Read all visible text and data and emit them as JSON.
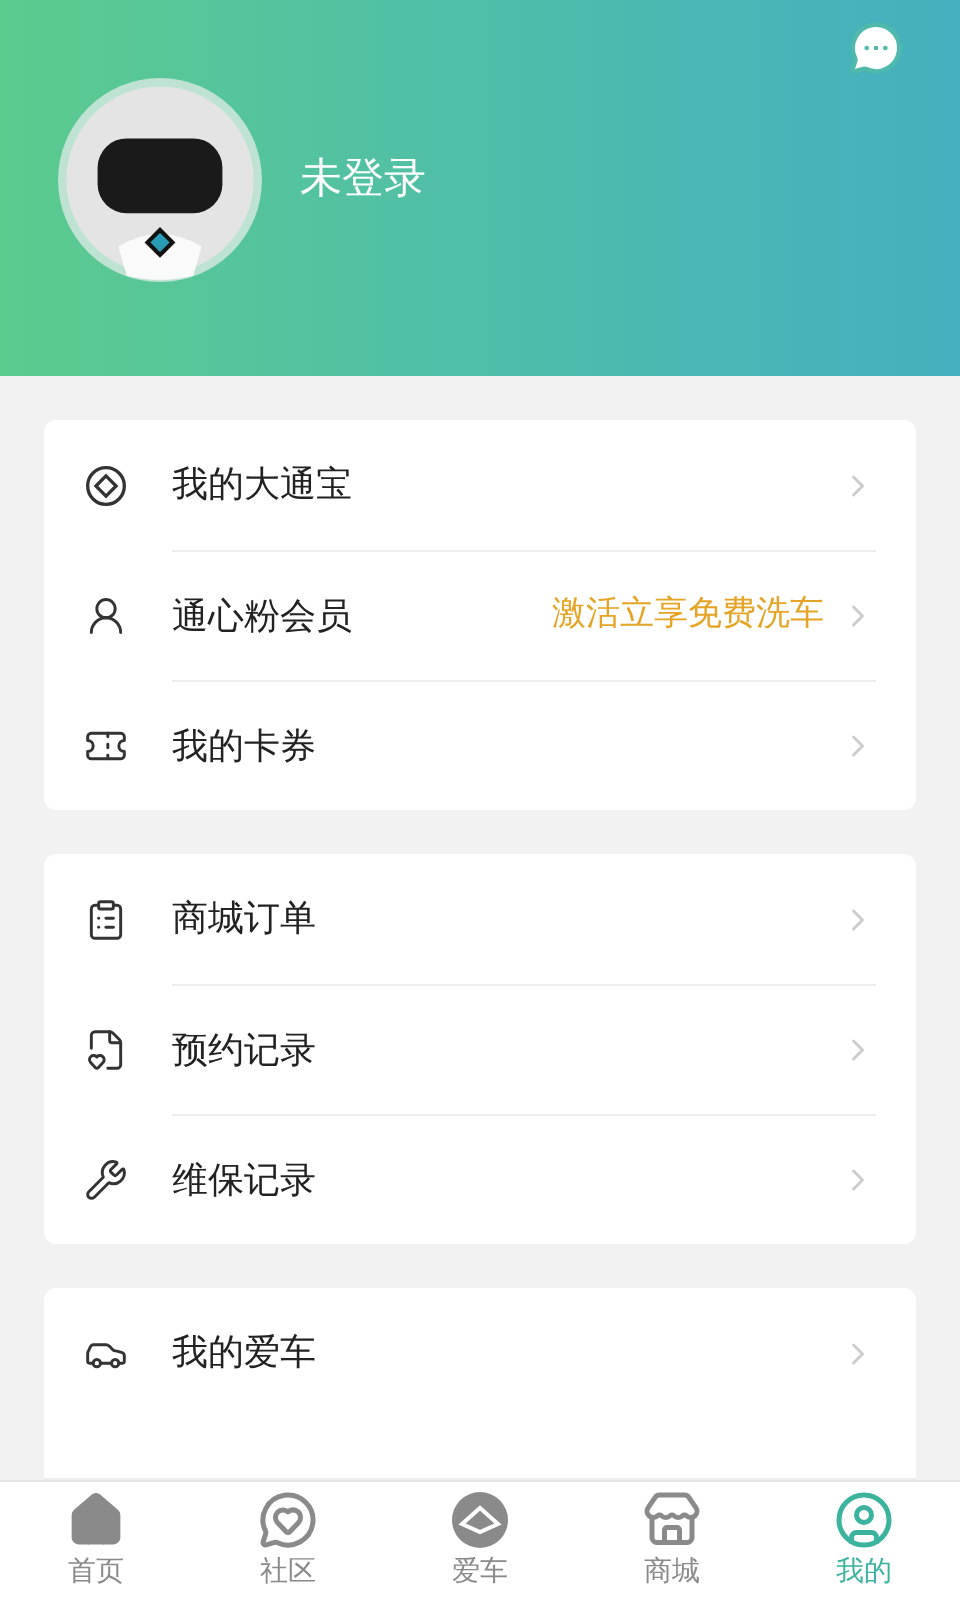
{
  "header": {
    "username": "未登录"
  },
  "groups": [
    {
      "items": [
        {
          "kind": "wallet",
          "label": "我的大通宝"
        },
        {
          "kind": "member",
          "label": "通心粉会员",
          "note": "激活立享免费洗车"
        },
        {
          "kind": "coupon",
          "label": "我的卡券"
        }
      ]
    },
    {
      "items": [
        {
          "kind": "order",
          "label": "商城订单"
        },
        {
          "kind": "booking",
          "label": "预约记录"
        },
        {
          "kind": "repair",
          "label": "维保记录"
        }
      ]
    },
    {
      "items": [
        {
          "kind": "car",
          "label": "我的爱车"
        }
      ]
    }
  ],
  "tabs": [
    {
      "kind": "home",
      "label": "首页",
      "selected": false
    },
    {
      "kind": "community",
      "label": "社区",
      "selected": false
    },
    {
      "kind": "car",
      "label": "爱车",
      "selected": false
    },
    {
      "kind": "store",
      "label": "商城",
      "selected": false
    },
    {
      "kind": "me",
      "label": "我的",
      "selected": true
    }
  ]
}
